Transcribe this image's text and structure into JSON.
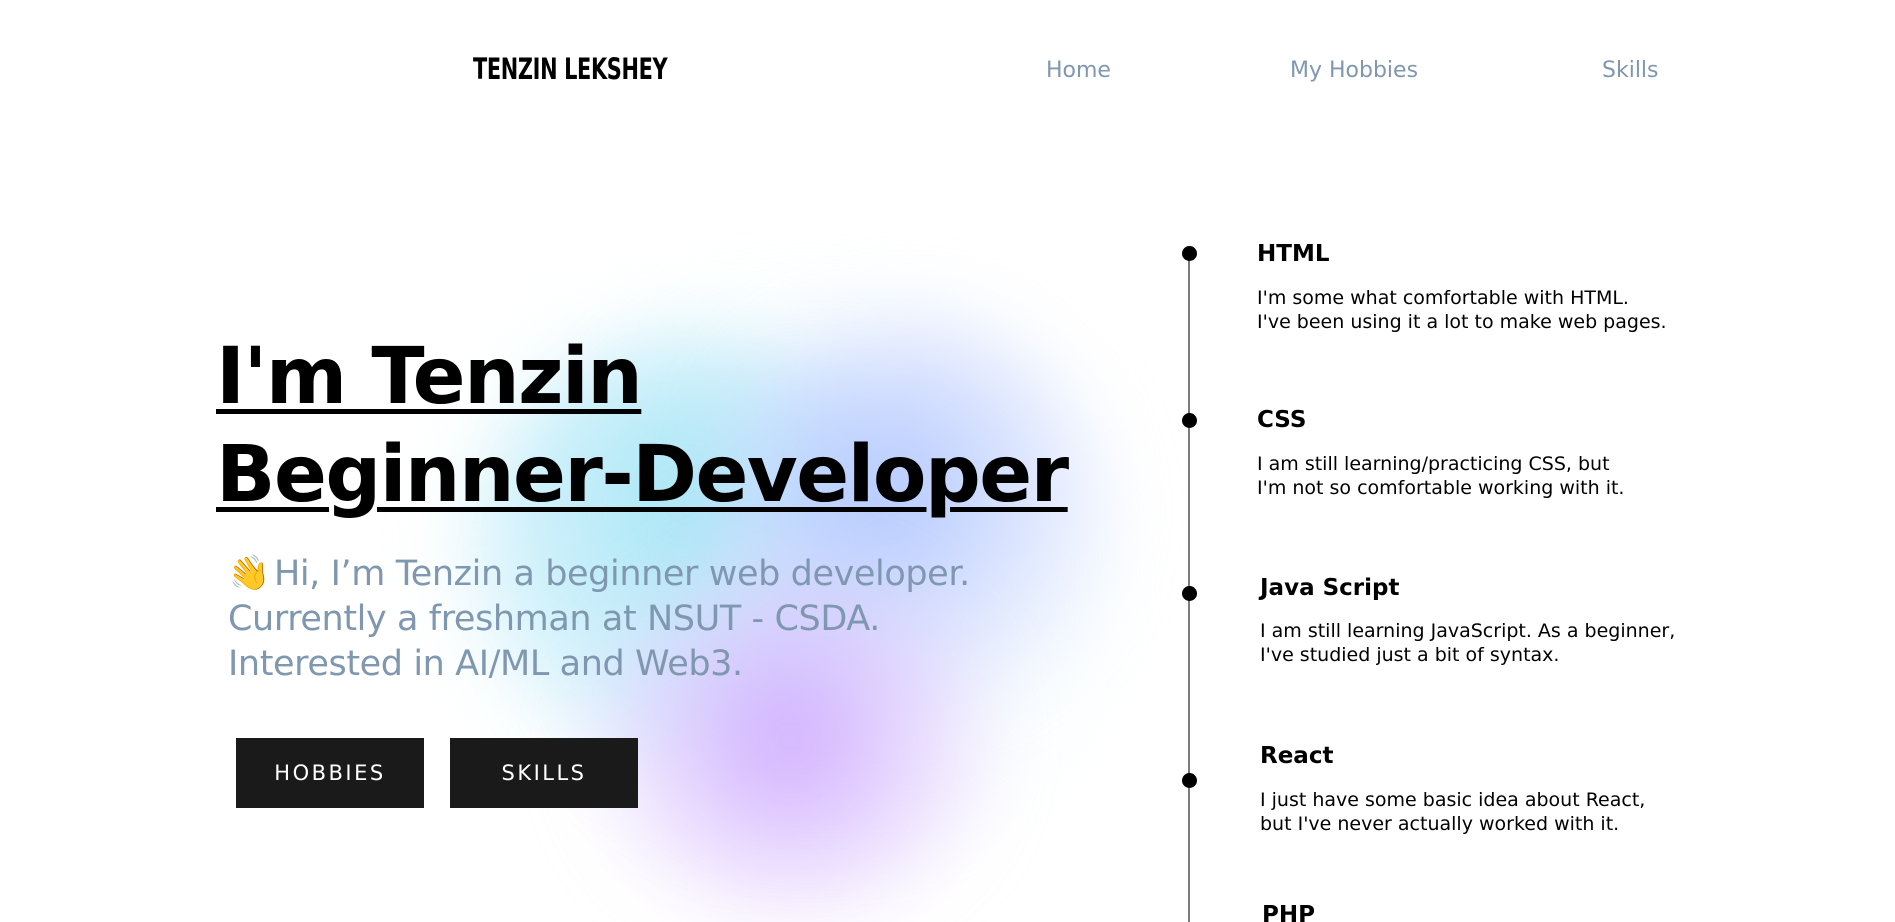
{
  "header": {
    "logo": "TENZIN LEKSHEY",
    "nav": [
      {
        "label": "Home"
      },
      {
        "label": "My Hobbies"
      },
      {
        "label": "Skills"
      }
    ]
  },
  "hero": {
    "heading_line1": "I'm Tenzin",
    "heading_line2": "Beginner-Developer",
    "wave_emoji": "👋",
    "intro_line1": "Hi, I’m Tenzin a beginner web developer.",
    "intro_line2": "Currently a freshman at NSUT - CSDA.",
    "intro_line3": "Interested in AI/ML and Web3.",
    "buttons": {
      "hobbies": "HOBBIES",
      "skills": "SKILLS"
    }
  },
  "skills": [
    {
      "title": "HTML",
      "desc_line1": "I'm some what comfortable with HTML.",
      "desc_line2": "I've been using it a lot to make web pages."
    },
    {
      "title": "CSS",
      "desc_line1": "I am still learning/practicing CSS, but",
      "desc_line2": "I'm not so comfortable working with it."
    },
    {
      "title": "Java Script",
      "desc_line1": "I am still learning JavaScript. As a beginner,",
      "desc_line2": "I've studied just a bit of syntax."
    },
    {
      "title": "React",
      "desc_line1": "I just have some basic idea about React,",
      "desc_line2": "but I've never actually worked with it."
    },
    {
      "title": "PHP"
    }
  ],
  "colors": {
    "nav_text": "#7f98b0",
    "intro_text": "#7f98b0",
    "button_bg": "#1a1a1a",
    "button_text": "#ffffff",
    "heading_text": "#000000"
  }
}
